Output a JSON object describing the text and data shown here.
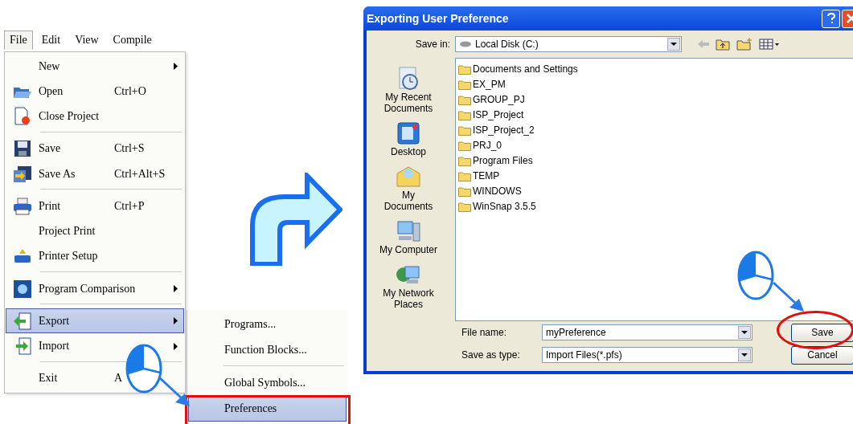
{
  "menu_bar": [
    {
      "label": "File",
      "selected": true
    },
    {
      "label": "Edit",
      "selected": false
    },
    {
      "label": "View",
      "selected": false
    },
    {
      "label": "Compile",
      "selected": false
    }
  ],
  "file_menu": [
    {
      "kind": "item",
      "label": "New",
      "submenu": true,
      "selected": false
    },
    {
      "kind": "item",
      "label": "Open",
      "shortcut": "Ctrl+O",
      "selected": false
    },
    {
      "kind": "item",
      "label": "Close Project",
      "selected": false
    },
    {
      "kind": "separator"
    },
    {
      "kind": "item",
      "label": "Save",
      "shortcut": "Ctrl+S",
      "selected": false
    },
    {
      "kind": "item",
      "label": "Save As",
      "shortcut": "Ctrl+Alt+S",
      "selected": false
    },
    {
      "kind": "separator"
    },
    {
      "kind": "item",
      "label": "Print",
      "shortcut": "Ctrl+P",
      "selected": false
    },
    {
      "kind": "item",
      "label": "Project Print",
      "selected": false
    },
    {
      "kind": "item",
      "label": "Printer Setup",
      "selected": false
    },
    {
      "kind": "separator"
    },
    {
      "kind": "item",
      "label": "Program Comparison",
      "submenu": true,
      "selected": false
    },
    {
      "kind": "separator"
    },
    {
      "kind": "item",
      "label": "Export",
      "submenu": true,
      "selected": true
    },
    {
      "kind": "item",
      "label": "Import",
      "submenu": true,
      "selected": false
    },
    {
      "kind": "separator"
    },
    {
      "kind": "item",
      "label": "Exit",
      "shortcut": "A",
      "selected": false
    }
  ],
  "export_submenu": [
    {
      "kind": "item",
      "label": "Programs...",
      "selected": false,
      "highlighted": false
    },
    {
      "kind": "item",
      "label": "Function Blocks...",
      "selected": false,
      "highlighted": false
    },
    {
      "kind": "separator"
    },
    {
      "kind": "item",
      "label": "Global Symbols...",
      "selected": false,
      "highlighted": false
    },
    {
      "kind": "item",
      "label": "Preferences",
      "selected": true,
      "highlighted": true
    }
  ],
  "dialog": {
    "title": "Exporting User Preference",
    "save_in": {
      "label": "Save in:",
      "value": "Local Disk (C:)"
    },
    "places": [
      {
        "label": "My Recent Documents"
      },
      {
        "label": "Desktop"
      },
      {
        "label": "My Documents"
      },
      {
        "label": "My Computer"
      },
      {
        "label": "My Network Places"
      }
    ],
    "files": [
      "Documents and Settings",
      "EX_PM",
      "GROUP_PJ",
      "ISP_Project",
      "ISP_Project_2",
      "PRJ_0",
      "Program Files",
      "TEMP",
      "WINDOWS",
      "WinSnap 3.5.5"
    ],
    "file_name": {
      "label": "File name:",
      "value": "myPreference"
    },
    "save_as_type": {
      "label": "Save as type:",
      "value": "Import Files(*.pfs)"
    },
    "buttons": [
      {
        "label": "Save",
        "highlighted": true
      },
      {
        "label": "Cancel",
        "highlighted": false
      }
    ]
  }
}
